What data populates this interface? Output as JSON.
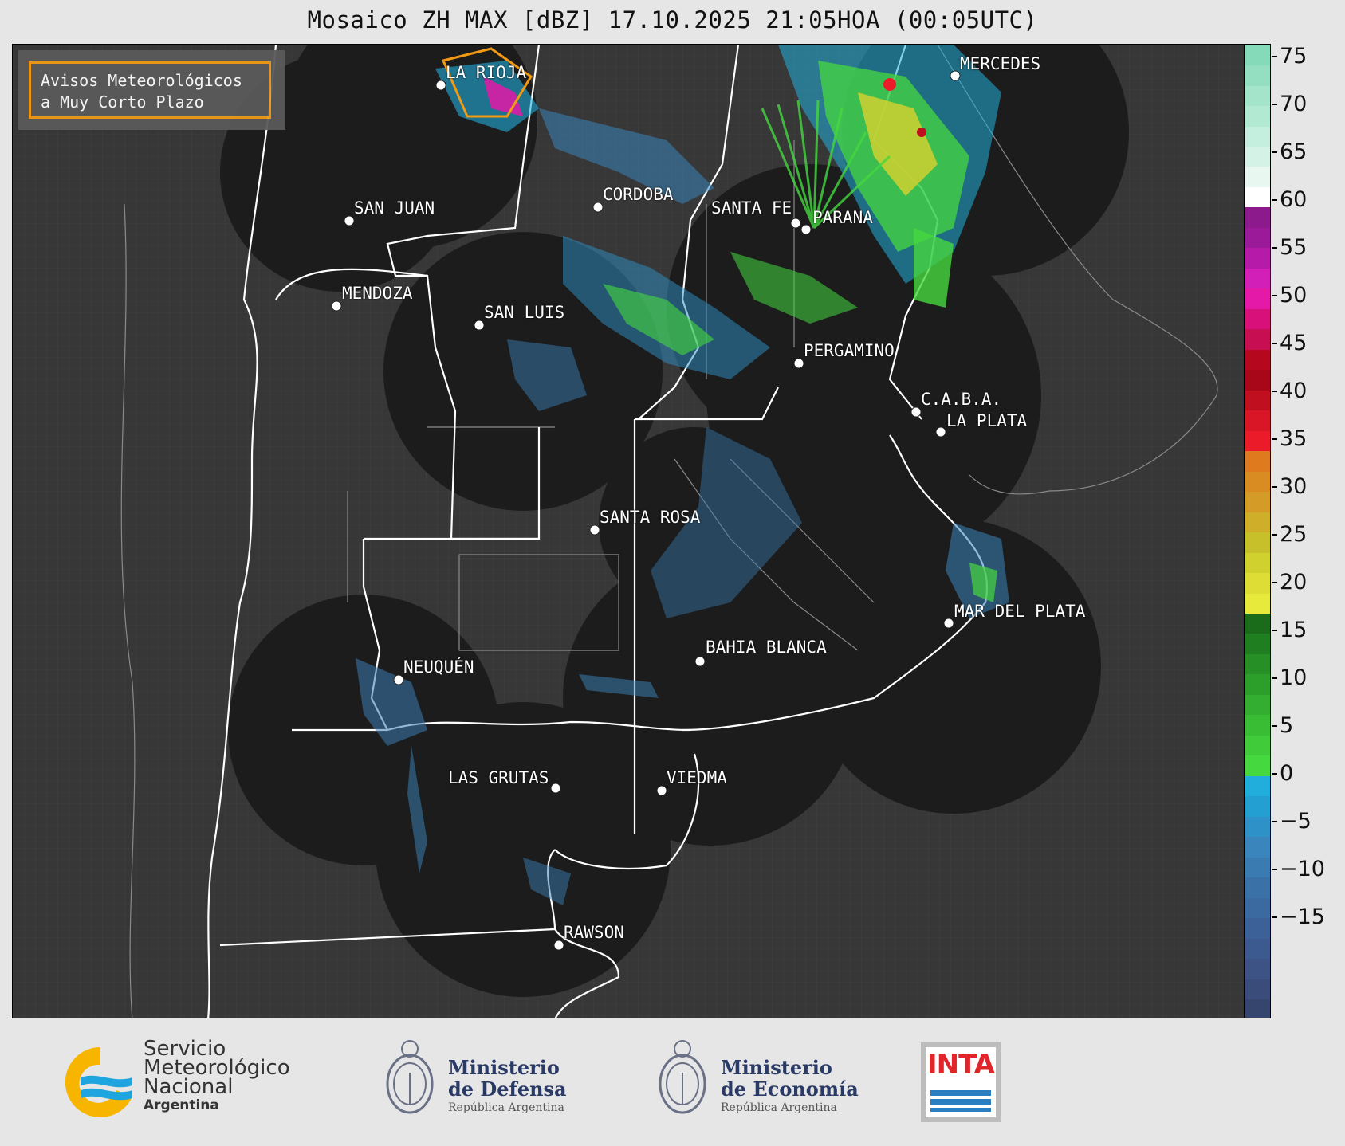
{
  "title": "Mosaico ZH MAX [dBZ] 17.10.2025 21:05HOA (00:05UTC)",
  "alert_box": {
    "line1": "Avisos Meteorológicos",
    "line2": "a Muy Corto Plazo"
  },
  "colorbar": {
    "ticks": [
      "75",
      "70",
      "65",
      "60",
      "55",
      "50",
      "45",
      "40",
      "35",
      "30",
      "25",
      "20",
      "15",
      "10",
      "5",
      "0",
      "−5",
      "−10",
      "−15"
    ],
    "colors": [
      "#35456e",
      "#3a4c7a",
      "#3d5285",
      "#3d5a90",
      "#3b6198",
      "#3a6aa0",
      "#3a72a8",
      "#3a7bb1",
      "#3a85bb",
      "#2e92c8",
      "#249fd1",
      "#22aedc",
      "#46d83f",
      "#3fcb3a",
      "#39bd35",
      "#33ae30",
      "#2c9e2a",
      "#268f25",
      "#1f7e1f",
      "#1a6b1a",
      "#e8ea3b",
      "#dddd35",
      "#d0d02f",
      "#c7c02b",
      "#cfae29",
      "#d49c26",
      "#d98c22",
      "#e07a1f",
      "#ec1b2a",
      "#d91626",
      "#c01020",
      "#a8071a",
      "#b5071e",
      "#c80e52",
      "#d8117a",
      "#e419a8",
      "#d21fb7",
      "#b51aa8",
      "#9b1a9a",
      "#8c1a8c",
      "#ffffff",
      "#e8f7f0",
      "#d5f2e6",
      "#c4eedd",
      "#b2e9d3",
      "#a3e4cb",
      "#94dfc2",
      "#85dbb9"
    ]
  },
  "cities": [
    {
      "name": "LA RIOJA"
    },
    {
      "name": "MERCEDES"
    },
    {
      "name": "SAN JUAN"
    },
    {
      "name": "CORDOBA"
    },
    {
      "name": "SANTA FE"
    },
    {
      "name": "PARANA"
    },
    {
      "name": "MENDOZA"
    },
    {
      "name": "SAN LUIS"
    },
    {
      "name": "PERGAMINO"
    },
    {
      "name": "C.A.B.A."
    },
    {
      "name": "LA PLATA"
    },
    {
      "name": "SANTA ROSA"
    },
    {
      "name": "MAR DEL PLATA"
    },
    {
      "name": "NEUQUÉN"
    },
    {
      "name": "BAHIA BLANCA"
    },
    {
      "name": "LAS GRUTAS"
    },
    {
      "name": "VIEDMA"
    },
    {
      "name": "RAWSON"
    }
  ],
  "footer": {
    "smn_line1": "Servicio",
    "smn_line2": "Meteorológico",
    "smn_line3": "Nacional",
    "smn_line4": "Argentina",
    "defensa_line1": "Ministerio",
    "defensa_line2": "de Defensa",
    "defensa_line3": "República Argentina",
    "economia_line1": "Ministerio",
    "economia_line2": "de Economía",
    "economia_line3": "República Argentina",
    "inta": "INTA"
  }
}
